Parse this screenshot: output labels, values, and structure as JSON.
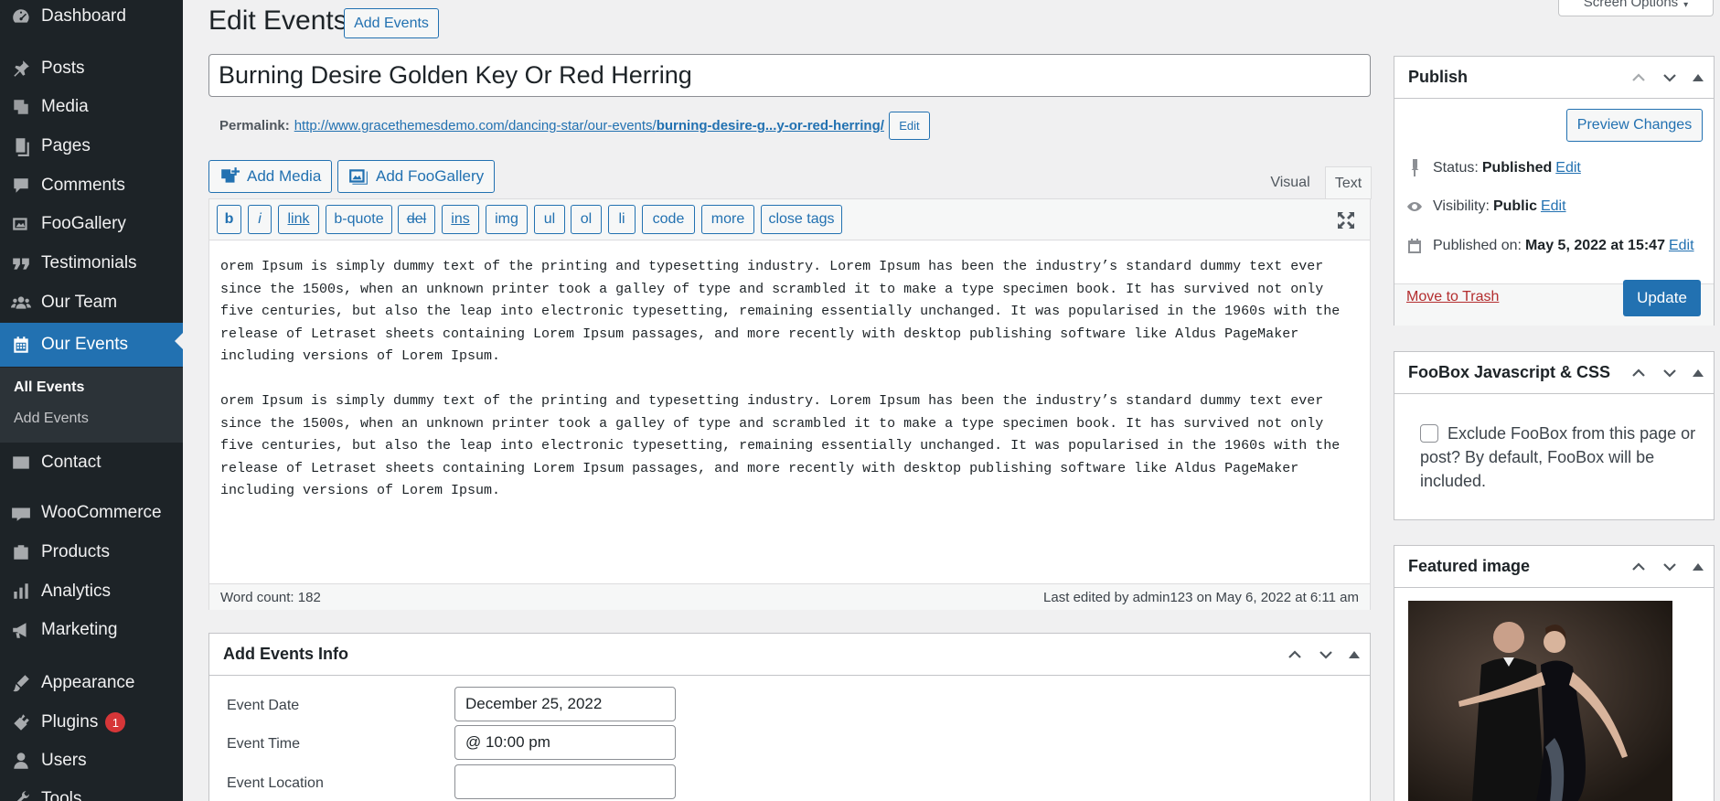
{
  "sidebar": {
    "items": [
      {
        "label": "Dashboard",
        "icon": "dashboard-icon"
      },
      {
        "label": "Posts",
        "icon": "pin-icon"
      },
      {
        "label": "Media",
        "icon": "media-icon"
      },
      {
        "label": "Pages",
        "icon": "pages-icon"
      },
      {
        "label": "Comments",
        "icon": "comment-icon"
      },
      {
        "label": "FooGallery",
        "icon": "gallery-icon"
      },
      {
        "label": "Testimonials",
        "icon": "quote-icon"
      },
      {
        "label": "Our Team",
        "icon": "group-icon"
      },
      {
        "label": "Our Events",
        "icon": "calendar-icon"
      },
      {
        "label": "Contact",
        "icon": "email-icon"
      },
      {
        "label": "WooCommerce",
        "icon": "woo-icon"
      },
      {
        "label": "Products",
        "icon": "products-icon"
      },
      {
        "label": "Analytics",
        "icon": "chart-bar-icon"
      },
      {
        "label": "Marketing",
        "icon": "megaphone-icon"
      },
      {
        "label": "Appearance",
        "icon": "brush-icon"
      },
      {
        "label": "Plugins",
        "icon": "plugin-icon",
        "badge": "1"
      },
      {
        "label": "Users",
        "icon": "user-icon"
      },
      {
        "label": "Tools",
        "icon": "tools-icon"
      }
    ],
    "submenu": {
      "all_events": "All Events",
      "add_events": "Add Events"
    }
  },
  "header": {
    "title": "Edit Events",
    "add_button": "Add Events",
    "screen_options": "Screen Options"
  },
  "post": {
    "title": "Burning Desire Golden Key Or Red Herring",
    "permalink_label": "Permalink:",
    "permalink_base": "http://www.gracethemesdemo.com/dancing-star/our-events/",
    "permalink_slug": "burning-desire-g...y-or-red-herring/",
    "permalink_edit": "Edit"
  },
  "editor": {
    "add_media": "Add Media",
    "add_foogallery": "Add FooGallery",
    "tab_visual": "Visual",
    "tab_text": "Text",
    "quicktags": [
      "b",
      "i",
      "link",
      "b-quote",
      "del",
      "ins",
      "img",
      "ul",
      "ol",
      "li",
      "code",
      "more",
      "close tags"
    ],
    "paragraphs": [
      "orem Ipsum is simply dummy text of the printing and typesetting industry. Lorem Ipsum has been the industry’s standard dummy text ever since the 1500s, when an unknown printer took a galley of type and scrambled it to make a type specimen book. It has survived not only five centuries, but also the leap into electronic typesetting, remaining essentially unchanged. It was popularised in the 1960s with the release of Letraset sheets containing Lorem Ipsum passages, and more recently with desktop publishing software like Aldus PageMaker including versions of Lorem Ipsum.",
      "orem Ipsum is simply dummy text of the printing and typesetting industry. Lorem Ipsum has been the industry’s standard dummy text ever since the 1500s, when an unknown printer took a galley of type and scrambled it to make a type specimen book. It has survived not only five centuries, but also the leap into electronic typesetting, remaining essentially unchanged. It was popularised in the 1960s with the release of Letraset sheets containing Lorem Ipsum passages, and more recently with desktop publishing software like Aldus PageMaker including versions of Lorem Ipsum."
    ],
    "word_count": "Word count: 182",
    "last_edited": "Last edited by admin123 on May 6, 2022 at 6:11 am"
  },
  "events_info": {
    "title": "Add Events Info",
    "date_label": "Event Date",
    "date_value": "December 25, 2022",
    "time_label": "Event Time",
    "time_value": "@ 10:00 pm",
    "location_label": "Event Location",
    "location_value": ""
  },
  "publish": {
    "title": "Publish",
    "preview": "Preview Changes",
    "status_label": "Status:",
    "status_value": "Published",
    "visibility_label": "Visibility:",
    "visibility_value": "Public",
    "published_label": "Published on:",
    "published_value": "May 5, 2022 at 15:47",
    "edit": "Edit",
    "trash": "Move to Trash",
    "update": "Update"
  },
  "foobox": {
    "title": "FooBox Javascript & CSS",
    "checkbox_label": "Exclude FooBox from this page or post? By default, FooBox will be included."
  },
  "featured": {
    "title": "Featured image"
  },
  "colors": {
    "accent": "#2271b1",
    "sidebar": "#1d2327",
    "badge": "#d63638",
    "trash": "#b32d2e"
  }
}
